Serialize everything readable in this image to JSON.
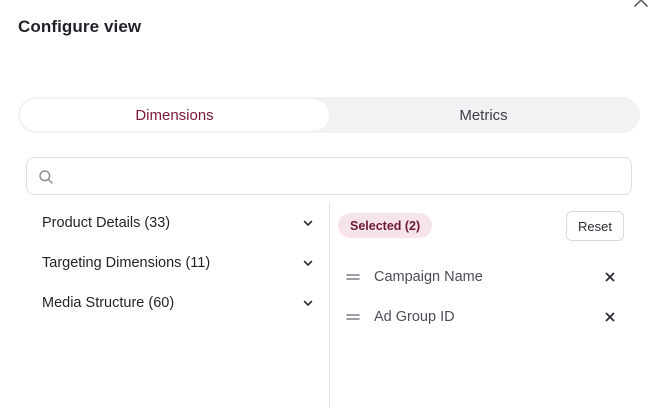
{
  "dialog": {
    "title": "Configure view"
  },
  "tabs": [
    {
      "label": "Dimensions",
      "active": true
    },
    {
      "label": "Metrics",
      "active": false
    }
  ],
  "search": {
    "placeholder": "",
    "value": ""
  },
  "categories": [
    {
      "label": "Product Details (33)"
    },
    {
      "label": "Targeting Dimensions (11)"
    },
    {
      "label": "Media Structure (60)"
    }
  ],
  "selected": {
    "badge_label": "Selected (2)",
    "reset_label": "Reset",
    "items": [
      {
        "label": "Campaign Name"
      },
      {
        "label": "Ad Group ID"
      }
    ]
  },
  "colors": {
    "accent": "#7a1838",
    "badge_bg": "#f7e4e8",
    "tab_track": "#f1f2f4"
  },
  "icons": [
    "close-icon",
    "search-icon",
    "chevron-down-icon",
    "drag-handle-icon",
    "remove-icon"
  ]
}
